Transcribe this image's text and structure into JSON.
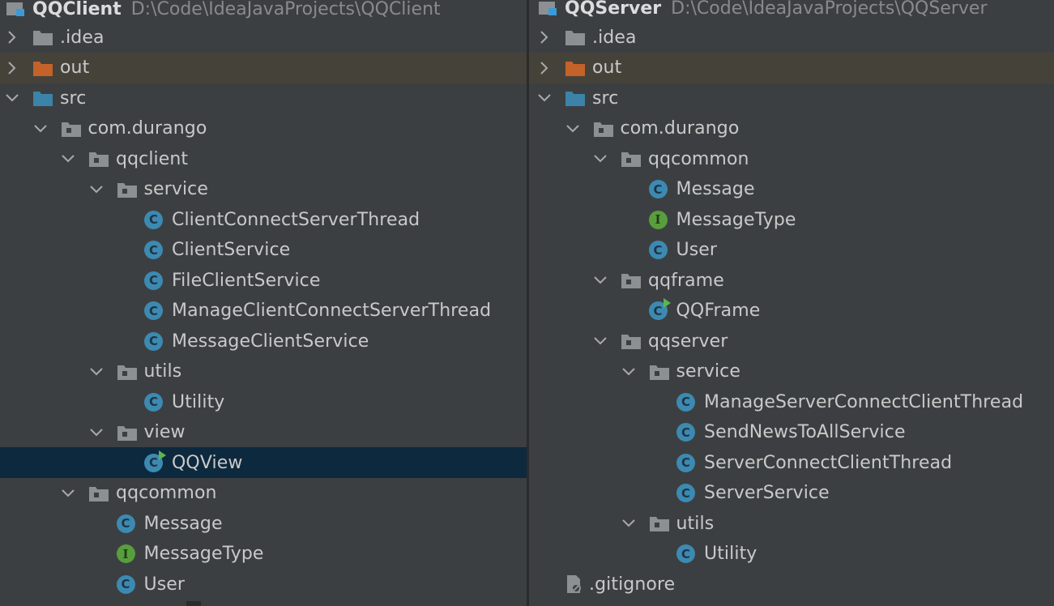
{
  "left": {
    "project_name": "QQClient",
    "project_path": "D:\\Code\\IdeaJavaProjects\\QQClient",
    "rows": [
      {
        "label": ".idea",
        "kind": "folder",
        "depth": 0,
        "arrow": "right"
      },
      {
        "label": "out",
        "kind": "folder-orange",
        "depth": 0,
        "arrow": "right",
        "state": "dim"
      },
      {
        "label": "src",
        "kind": "folder-blue",
        "depth": 0,
        "arrow": "down"
      },
      {
        "label": "com.durango",
        "kind": "package",
        "depth": 1,
        "arrow": "down"
      },
      {
        "label": "qqclient",
        "kind": "package",
        "depth": 2,
        "arrow": "down"
      },
      {
        "label": "service",
        "kind": "package",
        "depth": 3,
        "arrow": "down"
      },
      {
        "label": "ClientConnectServerThread",
        "kind": "class",
        "depth": 4
      },
      {
        "label": "ClientService",
        "kind": "class",
        "depth": 4
      },
      {
        "label": "FileClientService",
        "kind": "class",
        "depth": 4
      },
      {
        "label": "ManageClientConnectServerThread",
        "kind": "class",
        "depth": 4
      },
      {
        "label": "MessageClientService",
        "kind": "class",
        "depth": 4
      },
      {
        "label": "utils",
        "kind": "package",
        "depth": 3,
        "arrow": "down"
      },
      {
        "label": "Utility",
        "kind": "class",
        "depth": 4
      },
      {
        "label": "view",
        "kind": "package",
        "depth": 3,
        "arrow": "down"
      },
      {
        "label": "QQView",
        "kind": "class-run",
        "depth": 4,
        "state": "selected"
      },
      {
        "label": "qqcommon",
        "kind": "package",
        "depth": 2,
        "arrow": "down"
      },
      {
        "label": "Message",
        "kind": "class",
        "depth": 3
      },
      {
        "label": "MessageType",
        "kind": "interface",
        "depth": 3
      },
      {
        "label": "User",
        "kind": "class",
        "depth": 3
      }
    ]
  },
  "right": {
    "project_name": "QQServer",
    "project_path": "D:\\Code\\IdeaJavaProjects\\QQServer",
    "rows": [
      {
        "label": ".idea",
        "kind": "folder",
        "depth": 0,
        "arrow": "right"
      },
      {
        "label": "out",
        "kind": "folder-orange",
        "depth": 0,
        "arrow": "right",
        "state": "dim"
      },
      {
        "label": "src",
        "kind": "folder-blue",
        "depth": 0,
        "arrow": "down"
      },
      {
        "label": "com.durango",
        "kind": "package",
        "depth": 1,
        "arrow": "down"
      },
      {
        "label": "qqcommon",
        "kind": "package",
        "depth": 2,
        "arrow": "down"
      },
      {
        "label": "Message",
        "kind": "class",
        "depth": 3
      },
      {
        "label": "MessageType",
        "kind": "interface",
        "depth": 3
      },
      {
        "label": "User",
        "kind": "class",
        "depth": 3
      },
      {
        "label": "qqframe",
        "kind": "package",
        "depth": 2,
        "arrow": "down"
      },
      {
        "label": "QQFrame",
        "kind": "class-run",
        "depth": 3
      },
      {
        "label": "qqserver",
        "kind": "package",
        "depth": 2,
        "arrow": "down"
      },
      {
        "label": "service",
        "kind": "package",
        "depth": 3,
        "arrow": "down"
      },
      {
        "label": "ManageServerConnectClientThread",
        "kind": "class",
        "depth": 4
      },
      {
        "label": "SendNewsToAllService",
        "kind": "class",
        "depth": 4
      },
      {
        "label": "ServerConnectClientThread",
        "kind": "class",
        "depth": 4
      },
      {
        "label": "ServerService",
        "kind": "class",
        "depth": 4
      },
      {
        "label": "utils",
        "kind": "package",
        "depth": 3,
        "arrow": "down"
      },
      {
        "label": "Utility",
        "kind": "class",
        "depth": 4
      },
      {
        "label": ".gitignore",
        "kind": "gitignore",
        "depth": 0
      }
    ]
  },
  "icons": {
    "folder": "folder-icon",
    "folder-orange": "excluded-folder-icon",
    "folder-blue": "source-folder-icon",
    "package": "package-icon",
    "class": "class-icon",
    "class-run": "runnable-class-icon",
    "interface": "interface-icon",
    "gitignore": "gitignore-file-icon"
  },
  "colors": {
    "background": "#3c3f41",
    "dim_row": "#45423a",
    "selected_row": "#0d293e",
    "class_icon": "#3c8ab2",
    "interface_icon": "#599e3c",
    "excluded_folder": "#c4622a",
    "source_folder": "#3b83a8",
    "folder": "#8c9093"
  },
  "glyphs": {
    "class_letter": "C",
    "interface_letter": "I"
  }
}
